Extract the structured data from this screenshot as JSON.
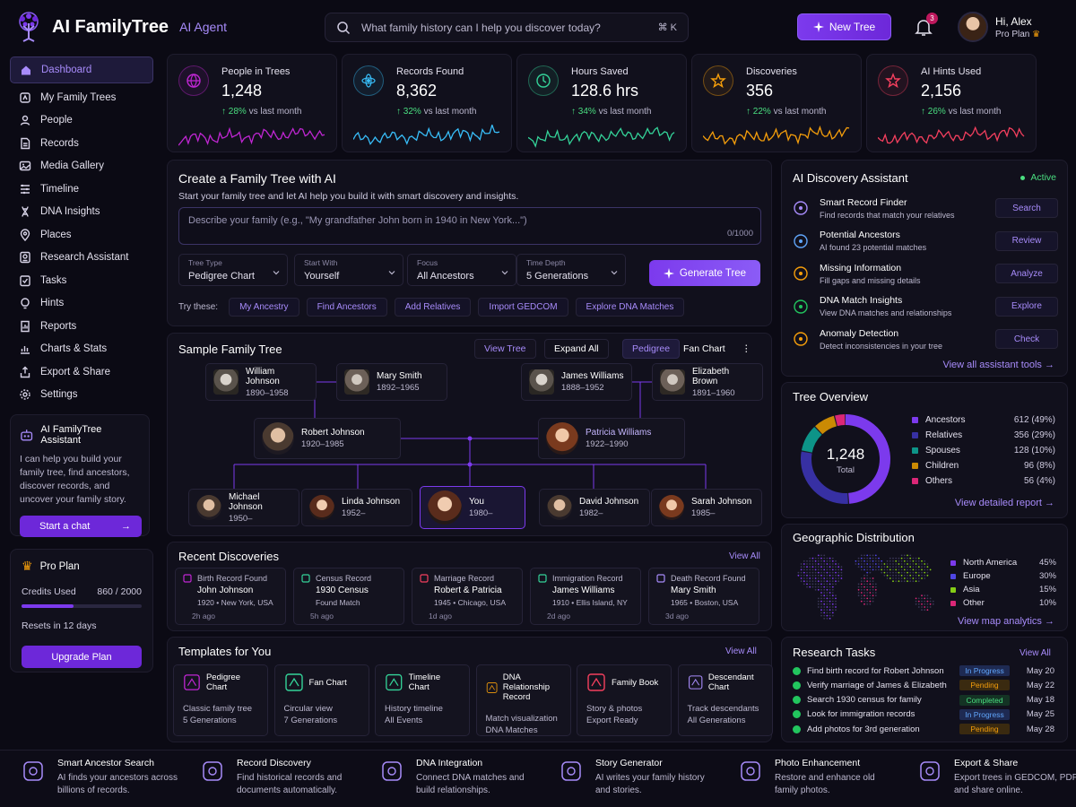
{
  "app": {
    "name": "AI FamilyTree",
    "tag": "AI Agent"
  },
  "search": {
    "placeholder": "What family history can I help you discover today?",
    "shortcut": "⌘ K"
  },
  "header": {
    "new_tree": "New Tree",
    "notifications": "3",
    "greeting": "Hi, Alex",
    "plan": "Pro Plan"
  },
  "nav": [
    {
      "label": "Dashboard",
      "icon": "home-icon"
    },
    {
      "label": "My Family Trees",
      "icon": "tree-icon"
    },
    {
      "label": "People",
      "icon": "person-icon"
    },
    {
      "label": "Records",
      "icon": "document-icon"
    },
    {
      "label": "Media Gallery",
      "icon": "image-icon"
    },
    {
      "label": "Timeline",
      "icon": "timeline-icon"
    },
    {
      "label": "DNA Insights",
      "icon": "dna-icon"
    },
    {
      "label": "Places",
      "icon": "pin-icon"
    },
    {
      "label": "Research Assistant",
      "icon": "research-icon"
    },
    {
      "label": "Tasks",
      "icon": "tasks-icon"
    },
    {
      "label": "Hints",
      "icon": "lightbulb-icon"
    },
    {
      "label": "Reports",
      "icon": "report-icon"
    },
    {
      "label": "Charts & Stats",
      "icon": "chart-icon"
    },
    {
      "label": "Export & Share",
      "icon": "export-icon"
    },
    {
      "label": "Settings",
      "icon": "gear-icon"
    }
  ],
  "assistant": {
    "title": "AI FamilyTree Assistant",
    "text": "I can help you build your family tree, find ancestors, discover records, and uncover your family story.",
    "button": "Start a chat"
  },
  "proplan": {
    "title": "Pro Plan",
    "credits_label": "Credits Used",
    "credits_value": "860 / 2000",
    "credits_fraction": 0.43,
    "resets": "Resets in 12 days",
    "button": "Upgrade Plan"
  },
  "stats": [
    {
      "label": "People in Trees",
      "value": "1,248",
      "change": "28%",
      "suffix": "vs last month",
      "color": "#c026d3"
    },
    {
      "label": "Records Found",
      "value": "8,362",
      "change": "32%",
      "suffix": "vs last month",
      "color": "#38bdf8"
    },
    {
      "label": "Hours Saved",
      "value": "128.6 hrs",
      "change": "34%",
      "suffix": "vs last month",
      "color": "#34d399"
    },
    {
      "label": "Discoveries",
      "value": "356",
      "change": "22%",
      "suffix": "vs last month",
      "color": "#f59e0b"
    },
    {
      "label": "AI Hints Used",
      "value": "2,156",
      "change": "26%",
      "suffix": "vs last month",
      "color": "#f43f5e"
    }
  ],
  "create": {
    "title": "Create a Family Tree with AI",
    "subtitle": "Start your family tree and let AI help you build it with smart discovery and insights.",
    "placeholder": "Describe your family (e.g., \"My grandfather John born in 1940 in New York...\")",
    "counter": "0/1000",
    "selects": [
      {
        "key": "Tree Type",
        "value": "Pedigree Chart"
      },
      {
        "key": "Start With",
        "value": "Yourself"
      },
      {
        "key": "Focus",
        "value": "All Ancestors"
      },
      {
        "key": "Time Depth",
        "value": "5 Generations"
      }
    ],
    "generate": "Generate Tree",
    "try_label": "Try these:",
    "chips": [
      "My Ancestry",
      "Find Ancestors",
      "Add Relatives",
      "Import GEDCOM",
      "Explore DNA Matches"
    ]
  },
  "tree": {
    "title": "Sample Family Tree",
    "buttons": {
      "view": "View Tree",
      "expand": "Expand All",
      "pedigree": "Pedigree",
      "fan": "Fan Chart"
    },
    "grandparents": [
      {
        "name": "William Johnson",
        "years": "1890–1958"
      },
      {
        "name": "Mary Smith",
        "years": "1892–1965"
      },
      {
        "name": "James Williams",
        "years": "1888–1952"
      },
      {
        "name": "Elizabeth Brown",
        "years": "1891–1960"
      }
    ],
    "parents": [
      {
        "name": "Robert Johnson",
        "years": "1920–1985"
      },
      {
        "name": "Patricia Williams",
        "years": "1922–1990"
      }
    ],
    "children": [
      {
        "name": "Michael Johnson",
        "years": "1950–"
      },
      {
        "name": "Linda Johnson",
        "years": "1952–"
      },
      {
        "name": "You",
        "years": "1980–"
      },
      {
        "name": "David Johnson",
        "years": "1982–"
      },
      {
        "name": "Sarah Johnson",
        "years": "1985–"
      }
    ]
  },
  "recent": {
    "title": "Recent Discoveries",
    "view_all": "View All",
    "items": [
      {
        "type": "Birth Record Found",
        "name": "John Johnson",
        "detail": "1920 • New York, USA",
        "ago": "2h ago",
        "color": "#c026d3"
      },
      {
        "type": "Census Record",
        "name": "1930 Census",
        "detail": "Found Match",
        "ago": "5h ago",
        "color": "#34d399"
      },
      {
        "type": "Marriage Record",
        "name": "Robert & Patricia",
        "detail": "1945 • Chicago, USA",
        "ago": "1d ago",
        "color": "#f43f5e"
      },
      {
        "type": "Immigration Record",
        "name": "James Williams",
        "detail": "1910 • Ellis Island, NY",
        "ago": "2d ago",
        "color": "#34d399"
      },
      {
        "type": "Death Record Found",
        "name": "Mary Smith",
        "detail": "1965 • Boston, USA",
        "ago": "3d ago",
        "color": "#a78bfa"
      }
    ]
  },
  "templates": {
    "title": "Templates for You",
    "view_all": "View All",
    "items": [
      {
        "name": "Pedigree Chart",
        "d1": "Classic family tree",
        "d2": "5 Generations",
        "color": "#c026d3"
      },
      {
        "name": "Fan Chart",
        "d1": "Circular view",
        "d2": "7 Generations",
        "color": "#34d399"
      },
      {
        "name": "Timeline Chart",
        "d1": "History timeline",
        "d2": "All Events",
        "color": "#34d399"
      },
      {
        "name": "DNA Relationship Record",
        "d1": "Match visualization",
        "d2": "DNA Matches",
        "color": "#f59e0b"
      },
      {
        "name": "Family Book",
        "d1": "Story & photos",
        "d2": "Export Ready",
        "color": "#f43f5e"
      },
      {
        "name": "Descendant Chart",
        "d1": "Track descendants",
        "d2": "All Generations",
        "color": "#a78bfa"
      }
    ]
  },
  "ai_discovery": {
    "title": "AI Discovery Assistant",
    "status": "Active",
    "items": [
      {
        "name": "Smart Record Finder",
        "desc": "Find records that match your relatives",
        "button": "Search",
        "color": "#a78bfa"
      },
      {
        "name": "Potential Ancestors",
        "desc": "AI found 23 potential matches",
        "button": "Review",
        "color": "#60a5fa"
      },
      {
        "name": "Missing Information",
        "desc": "Fill gaps and missing details",
        "button": "Analyze",
        "color": "#f59e0b"
      },
      {
        "name": "DNA Match Insights",
        "desc": "View DNA matches and relationships",
        "button": "Explore",
        "color": "#22c55e"
      },
      {
        "name": "Anomaly Detection",
        "desc": "Detect inconsistencies in your tree",
        "button": "Check",
        "color": "#f59e0b"
      }
    ],
    "view_all": "View all assistant tools"
  },
  "overview": {
    "title": "Tree Overview",
    "total": "1,248",
    "total_label": "Total",
    "segments": [
      {
        "name": "Ancestors",
        "value": "612 (49%)",
        "pct": 49,
        "color": "#7c3aed"
      },
      {
        "name": "Relatives",
        "value": "356 (29%)",
        "pct": 29,
        "color": "#3730a3"
      },
      {
        "name": "Spouses",
        "value": "128 (10%)",
        "pct": 10,
        "color": "#0d9488"
      },
      {
        "name": "Children",
        "value": "96 (8%)",
        "pct": 8,
        "color": "#ca8a04"
      },
      {
        "name": "Others",
        "value": "56 (4%)",
        "pct": 4,
        "color": "#db2777"
      }
    ],
    "report": "View detailed report"
  },
  "geo": {
    "title": "Geographic Distribution",
    "regions": [
      {
        "name": "North America",
        "value": "45%",
        "color": "#7c3aed"
      },
      {
        "name": "Europe",
        "value": "30%",
        "color": "#4f46e5"
      },
      {
        "name": "Asia",
        "value": "15%",
        "color": "#84cc16"
      },
      {
        "name": "Other",
        "value": "10%",
        "color": "#db2777"
      }
    ],
    "analytics": "View map analytics"
  },
  "tasks": {
    "title": "Research Tasks",
    "view_all": "View All",
    "items": [
      {
        "text": "Find birth record for Robert Johnson",
        "status": "In Progress",
        "kind": "prog",
        "date": "May 20"
      },
      {
        "text": "Verify marriage of James & Elizabeth",
        "status": "Pending",
        "kind": "pend",
        "date": "May 22"
      },
      {
        "text": "Search 1930 census for family",
        "status": "Completed",
        "kind": "done",
        "date": "May 18"
      },
      {
        "text": "Look for immigration records",
        "status": "In Progress",
        "kind": "prog",
        "date": "May 25"
      },
      {
        "text": "Add photos for 3rd generation",
        "status": "Pending",
        "kind": "pend",
        "date": "May 28"
      }
    ]
  },
  "features": [
    {
      "title": "Smart Ancestor Search",
      "desc": "AI finds your ancestors across billions of records."
    },
    {
      "title": "Record Discovery",
      "desc": "Find historical records and documents automatically."
    },
    {
      "title": "DNA Integration",
      "desc": "Connect DNA matches and build relationships."
    },
    {
      "title": "Story Generator",
      "desc": "AI writes your family history and stories."
    },
    {
      "title": "Photo Enhancement",
      "desc": "Restore and enhance old family photos."
    },
    {
      "title": "Export & Share",
      "desc": "Export trees in GEDCOM, PDF, and share online."
    }
  ]
}
